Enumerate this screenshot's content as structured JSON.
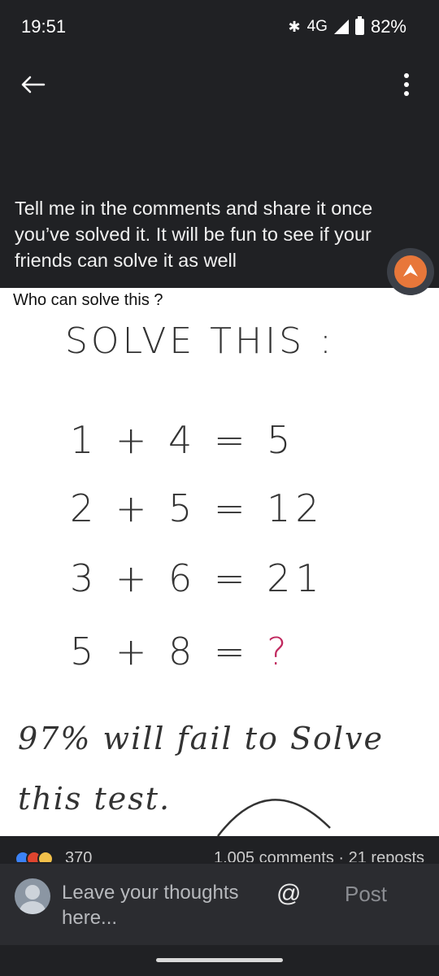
{
  "status_bar": {
    "time": "19:51",
    "network": "4G",
    "battery": "82%",
    "icons": [
      "bluetooth-icon",
      "signal-icon",
      "battery-icon"
    ]
  },
  "app_bar": {
    "back_icon": "arrow-left-icon",
    "more_icon": "more-vert-icon"
  },
  "post": {
    "text": "Tell me in the comments and share it once you’ve solved it. It will be fun to see if your friends can solve it as well",
    "image": {
      "caption": "Who can solve this ?",
      "title": "SOLVE THIS :",
      "equations": [
        "1 + 4  = 5",
        "2 + 5  = 12",
        "3 + 6  = 21",
        "5 + 8  = "
      ],
      "question_mark": "?",
      "footer_line1": "97% will fail to Solve",
      "footer_line2": "this test."
    }
  },
  "stats": {
    "reaction_count": "370",
    "comments_reposts": "1,005 comments · 21 reposts"
  },
  "comment_box": {
    "placeholder": "Leave your thoughts here...",
    "mention_label": "@",
    "post_label": "Post"
  },
  "colors": {
    "background": "#202124",
    "accent_avatar": "#e8773a",
    "question_mark": "#c0285e"
  }
}
